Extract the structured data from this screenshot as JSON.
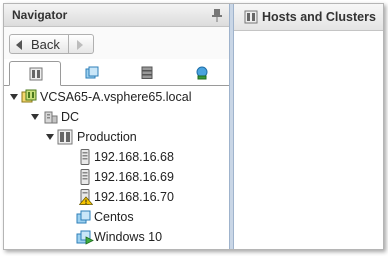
{
  "navigator": {
    "title": "Navigator",
    "back_label": "Back",
    "tabs": [
      {
        "name": "hosts-and-clusters",
        "icon": "hosts-clusters-icon"
      },
      {
        "name": "vms-and-templates",
        "icon": "vms-templates-icon"
      },
      {
        "name": "storage",
        "icon": "storage-icon"
      },
      {
        "name": "networking",
        "icon": "network-icon"
      }
    ],
    "tree": {
      "vcenter": "VCSA65-A.vsphere65.local",
      "datacenter": "DC",
      "cluster": "Production",
      "hosts": [
        "192.168.16.68",
        "192.168.16.69",
        "192.168.16.70"
      ],
      "vms": [
        "Centos",
        "Windows 10"
      ]
    }
  },
  "main": {
    "title": "Hosts and Clusters"
  }
}
